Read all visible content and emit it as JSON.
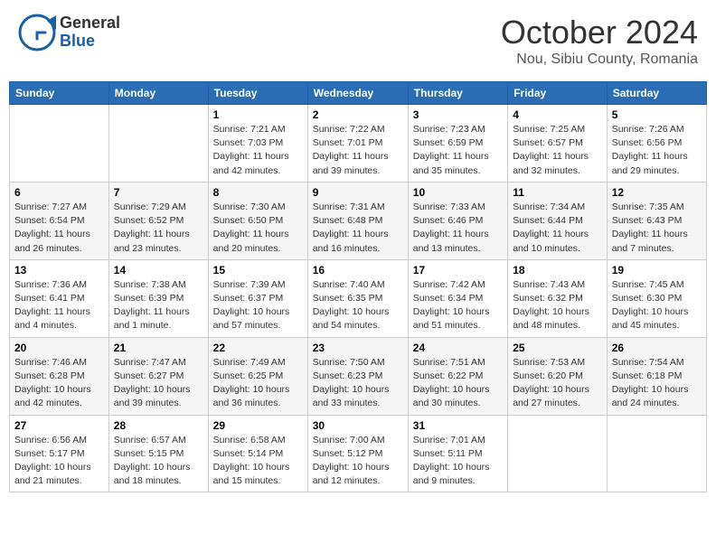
{
  "header": {
    "logo": {
      "general": "General",
      "blue": "Blue"
    },
    "title": "October 2024",
    "location": "Nou, Sibiu County, Romania"
  },
  "weekdays": [
    "Sunday",
    "Monday",
    "Tuesday",
    "Wednesday",
    "Thursday",
    "Friday",
    "Saturday"
  ],
  "weeks": [
    [
      {
        "day": "",
        "info": ""
      },
      {
        "day": "",
        "info": ""
      },
      {
        "day": "1",
        "info": "Sunrise: 7:21 AM\nSunset: 7:03 PM\nDaylight: 11 hours and 42 minutes."
      },
      {
        "day": "2",
        "info": "Sunrise: 7:22 AM\nSunset: 7:01 PM\nDaylight: 11 hours and 39 minutes."
      },
      {
        "day": "3",
        "info": "Sunrise: 7:23 AM\nSunset: 6:59 PM\nDaylight: 11 hours and 35 minutes."
      },
      {
        "day": "4",
        "info": "Sunrise: 7:25 AM\nSunset: 6:57 PM\nDaylight: 11 hours and 32 minutes."
      },
      {
        "day": "5",
        "info": "Sunrise: 7:26 AM\nSunset: 6:56 PM\nDaylight: 11 hours and 29 minutes."
      }
    ],
    [
      {
        "day": "6",
        "info": "Sunrise: 7:27 AM\nSunset: 6:54 PM\nDaylight: 11 hours and 26 minutes."
      },
      {
        "day": "7",
        "info": "Sunrise: 7:29 AM\nSunset: 6:52 PM\nDaylight: 11 hours and 23 minutes."
      },
      {
        "day": "8",
        "info": "Sunrise: 7:30 AM\nSunset: 6:50 PM\nDaylight: 11 hours and 20 minutes."
      },
      {
        "day": "9",
        "info": "Sunrise: 7:31 AM\nSunset: 6:48 PM\nDaylight: 11 hours and 16 minutes."
      },
      {
        "day": "10",
        "info": "Sunrise: 7:33 AM\nSunset: 6:46 PM\nDaylight: 11 hours and 13 minutes."
      },
      {
        "day": "11",
        "info": "Sunrise: 7:34 AM\nSunset: 6:44 PM\nDaylight: 11 hours and 10 minutes."
      },
      {
        "day": "12",
        "info": "Sunrise: 7:35 AM\nSunset: 6:43 PM\nDaylight: 11 hours and 7 minutes."
      }
    ],
    [
      {
        "day": "13",
        "info": "Sunrise: 7:36 AM\nSunset: 6:41 PM\nDaylight: 11 hours and 4 minutes."
      },
      {
        "day": "14",
        "info": "Sunrise: 7:38 AM\nSunset: 6:39 PM\nDaylight: 11 hours and 1 minute."
      },
      {
        "day": "15",
        "info": "Sunrise: 7:39 AM\nSunset: 6:37 PM\nDaylight: 10 hours and 57 minutes."
      },
      {
        "day": "16",
        "info": "Sunrise: 7:40 AM\nSunset: 6:35 PM\nDaylight: 10 hours and 54 minutes."
      },
      {
        "day": "17",
        "info": "Sunrise: 7:42 AM\nSunset: 6:34 PM\nDaylight: 10 hours and 51 minutes."
      },
      {
        "day": "18",
        "info": "Sunrise: 7:43 AM\nSunset: 6:32 PM\nDaylight: 10 hours and 48 minutes."
      },
      {
        "day": "19",
        "info": "Sunrise: 7:45 AM\nSunset: 6:30 PM\nDaylight: 10 hours and 45 minutes."
      }
    ],
    [
      {
        "day": "20",
        "info": "Sunrise: 7:46 AM\nSunset: 6:28 PM\nDaylight: 10 hours and 42 minutes."
      },
      {
        "day": "21",
        "info": "Sunrise: 7:47 AM\nSunset: 6:27 PM\nDaylight: 10 hours and 39 minutes."
      },
      {
        "day": "22",
        "info": "Sunrise: 7:49 AM\nSunset: 6:25 PM\nDaylight: 10 hours and 36 minutes."
      },
      {
        "day": "23",
        "info": "Sunrise: 7:50 AM\nSunset: 6:23 PM\nDaylight: 10 hours and 33 minutes."
      },
      {
        "day": "24",
        "info": "Sunrise: 7:51 AM\nSunset: 6:22 PM\nDaylight: 10 hours and 30 minutes."
      },
      {
        "day": "25",
        "info": "Sunrise: 7:53 AM\nSunset: 6:20 PM\nDaylight: 10 hours and 27 minutes."
      },
      {
        "day": "26",
        "info": "Sunrise: 7:54 AM\nSunset: 6:18 PM\nDaylight: 10 hours and 24 minutes."
      }
    ],
    [
      {
        "day": "27",
        "info": "Sunrise: 6:56 AM\nSunset: 5:17 PM\nDaylight: 10 hours and 21 minutes."
      },
      {
        "day": "28",
        "info": "Sunrise: 6:57 AM\nSunset: 5:15 PM\nDaylight: 10 hours and 18 minutes."
      },
      {
        "day": "29",
        "info": "Sunrise: 6:58 AM\nSunset: 5:14 PM\nDaylight: 10 hours and 15 minutes."
      },
      {
        "day": "30",
        "info": "Sunrise: 7:00 AM\nSunset: 5:12 PM\nDaylight: 10 hours and 12 minutes."
      },
      {
        "day": "31",
        "info": "Sunrise: 7:01 AM\nSunset: 5:11 PM\nDaylight: 10 hours and 9 minutes."
      },
      {
        "day": "",
        "info": ""
      },
      {
        "day": "",
        "info": ""
      }
    ]
  ]
}
